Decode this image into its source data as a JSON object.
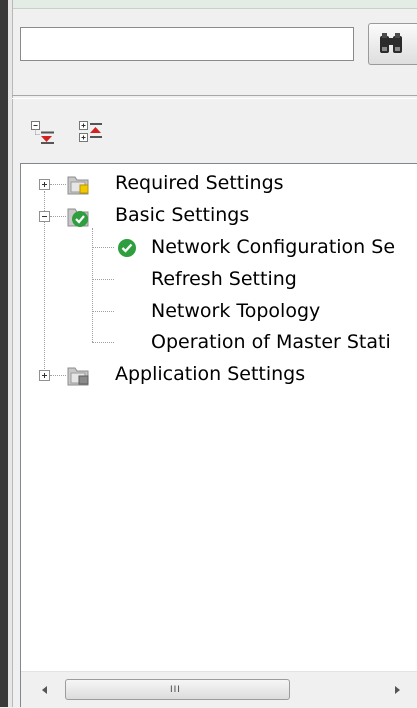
{
  "search": {
    "value": "",
    "placeholder": ""
  },
  "icons": {
    "search_button": "binoculars-icon",
    "collapse_all": "collapse-all-icon",
    "expand_all": "expand-all-icon"
  },
  "tree": {
    "required": {
      "label": "Required Settings"
    },
    "basic": {
      "label": "Basic Settings",
      "children": [
        {
          "label": "Network Configuration Se"
        },
        {
          "label": "Refresh Setting"
        },
        {
          "label": "Network Topology"
        },
        {
          "label": "Operation of Master Stati"
        }
      ]
    },
    "application": {
      "label": "Application Settings"
    }
  },
  "scrollbar": {
    "grip": "III"
  },
  "colors": {
    "check_green": "#2e9e3e",
    "folder": "#c8c8c8",
    "border": "#828790"
  }
}
